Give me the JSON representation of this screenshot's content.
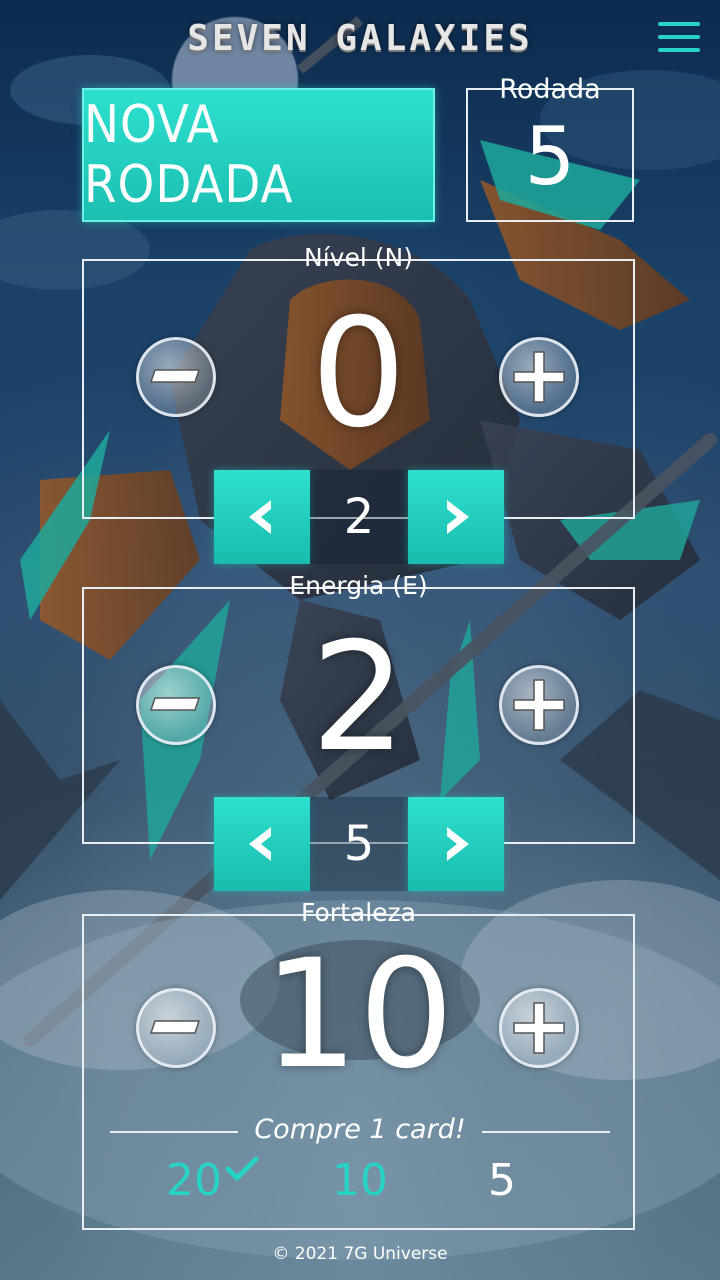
{
  "header": {
    "logo": "SEVEN GALAXIES",
    "menu_icon": "hamburger-menu-icon"
  },
  "new_round": {
    "label": "NOVA RODADA"
  },
  "rodada": {
    "label": "Rodada",
    "value": "5"
  },
  "nivel": {
    "label": "Nível (N)",
    "value": "0",
    "step": "2",
    "minus_icon": "minus-icon",
    "plus_icon": "plus-icon",
    "prev_icon": "chevron-left-icon",
    "next_icon": "chevron-right-icon"
  },
  "energia": {
    "label": "Energia (E)",
    "value": "2",
    "step": "5",
    "minus_icon": "minus-icon",
    "plus_icon": "plus-icon",
    "prev_icon": "chevron-left-icon",
    "next_icon": "chevron-right-icon"
  },
  "fortaleza": {
    "label": "Fortaleza",
    "value": "10",
    "hint": "Compre 1 card!",
    "tiers": [
      {
        "value": "20",
        "state": "checked"
      },
      {
        "value": "10",
        "state": "active"
      },
      {
        "value": "5",
        "state": "inactive"
      }
    ],
    "check_icon": "checkmark-icon"
  },
  "footer": {
    "copyright": "© 2021 7G Universe"
  },
  "colors": {
    "accent": "#27d3c4",
    "frame": "#e8eef2",
    "background": "#1a4168"
  }
}
